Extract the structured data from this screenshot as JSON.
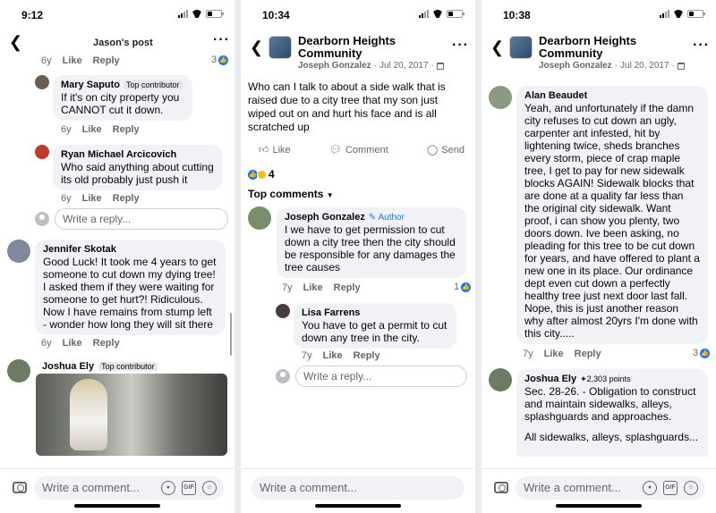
{
  "status": {
    "time1": "9:12",
    "time2": "10:34",
    "time3": "10:38"
  },
  "panel1": {
    "title": "Jason's post",
    "top_meta": {
      "age": "6y",
      "like": "Like",
      "reply": "Reply",
      "count": "3"
    },
    "comments": [
      {
        "name": "Mary Saputo",
        "badge": "Top contributor",
        "text": "If it's on city property you CANNOT cut it down.",
        "age": "6y",
        "like": "Like",
        "reply": "Reply"
      },
      {
        "name": "Ryan Michael Arcicovich",
        "text": "Who said anything about cutting its old probably just push it",
        "age": "6y",
        "like": "Like",
        "reply": "Reply"
      },
      {
        "name": "Jennifer Skotak",
        "text": "Good Luck! It took me 4 years to get someone to cut down my dying tree! I asked them if they were waiting for someone to get hurt?! Ridiculous. Now I have remains from stump left - wonder how long they will sit there",
        "age": "6y",
        "like": "Like",
        "reply": "Reply"
      },
      {
        "name": "Joshua Ely",
        "badge": "Top contributor"
      }
    ],
    "reply_placeholder": "Write a reply...",
    "compose_placeholder": "Write a comment..."
  },
  "panel2": {
    "group": "Dearborn Heights Community",
    "author": "Joseph Gonzalez",
    "date": "Jul 20, 2017",
    "post_text": "Who can I talk to about a side walk that is raised due to a city tree that my son just wiped out on and hurt his face and is all scratched up",
    "actions": {
      "like": "Like",
      "comment": "Comment",
      "send": "Send"
    },
    "reaction_count": "4",
    "top_comments": "Top comments",
    "comments": [
      {
        "name": "Joseph Gonzalez",
        "tag": "Author",
        "text": "I we have to get permission to cut down a city tree then the city should be responsible for any damages the tree causes",
        "age": "7y",
        "like": "Like",
        "reply": "Reply",
        "count": "1"
      },
      {
        "name": "Lisa Farrens",
        "text": "You have to get a permit to cut down any tree in the city.",
        "age": "7y",
        "like": "Like",
        "reply": "Reply"
      }
    ],
    "reply_placeholder": "Write a reply...",
    "compose_placeholder": "Write a comment..."
  },
  "panel3": {
    "group": "Dearborn Heights Community",
    "author": "Joseph Gonzalez",
    "date": "Jul 20, 2017",
    "comments": [
      {
        "name": "Alan Beaudet",
        "text": "Yeah, and unfortunately if the damn city refuses to cut down an ugly, carpenter ant infested, hit by lightening twice, sheds branches every storm, piece of crap maple tree, I get to pay for new sidewalk blocks AGAIN! Sidewalk blocks that are done at a quality far less than the original city sidewalk. Want proof, i can show you plenty, two doors down. Ive been asking, no pleading for this tree to be cut down for years, and have offered to plant a new one in its place. Our ordinance dept even cut down a perfectly healthy tree just next door last fall.\nNope, this is just another reason why after almost 20yrs I'm done with this city.....",
        "age": "7y",
        "like": "Like",
        "reply": "Reply",
        "count": "3"
      },
      {
        "name": "Joshua Ely",
        "points": "2,303 points",
        "text": "Sec. 28-26. - Obligation to construct and maintain sidewalks, alleys, splashguards and approaches.",
        "text2": "All sidewalks, alleys, splashguards..."
      }
    ],
    "compose_placeholder": "Write a comment..."
  },
  "footer_icons": [
    "camera-icon",
    "sticker-icon",
    "gif-icon",
    "emoji-icon"
  ],
  "gif_label": "GIF"
}
